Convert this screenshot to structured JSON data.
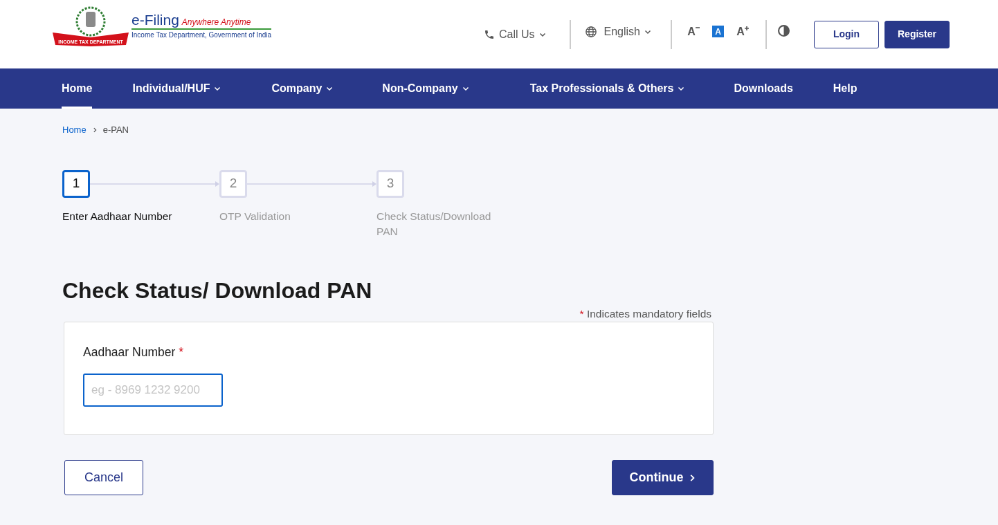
{
  "logo": {
    "ribbon": "INCOME TAX DEPARTMENT",
    "title": "e-Filing",
    "tagline": "Anywhere Anytime",
    "subtitle": "Income Tax Department, Government of India"
  },
  "header": {
    "call_us": {
      "label": "Call Us",
      "dropdown": true
    },
    "language": {
      "label": "English",
      "dropdown": true
    },
    "font_sizes": [
      {
        "label": "A",
        "kind": "decrease",
        "selected": false
      },
      {
        "label": "A",
        "kind": "normal",
        "selected": true
      },
      {
        "label": "A",
        "kind": "increase",
        "selected": false
      }
    ],
    "buttons": [
      {
        "label": "Login",
        "kind": "outline"
      },
      {
        "label": "Register",
        "kind": "primary"
      }
    ]
  },
  "nav": [
    {
      "label": "Home",
      "dropdown": false,
      "selected": true
    },
    {
      "label": "Individual/HUF",
      "dropdown": true,
      "selected": false
    },
    {
      "label": "Company",
      "dropdown": true,
      "selected": false
    },
    {
      "label": "Non-Company",
      "dropdown": true,
      "selected": false
    },
    {
      "label": "Tax Professionals & Others",
      "dropdown": true,
      "selected": false
    },
    {
      "label": "Downloads",
      "dropdown": false,
      "selected": false
    },
    {
      "label": "Help",
      "dropdown": false,
      "selected": false
    }
  ],
  "breadcrumb": [
    {
      "label": "Home",
      "link": true
    },
    {
      "label": "e-PAN",
      "link": false
    }
  ],
  "steps": [
    {
      "number": "1",
      "label": "Enter Aadhaar Number",
      "selected": true
    },
    {
      "number": "2",
      "label": "OTP Validation",
      "selected": false
    },
    {
      "number": "3",
      "label": "Check Status/Download PAN",
      "selected": false
    }
  ],
  "heading": "Check Status/ Download PAN",
  "mandatory_note": {
    "star": "*",
    "text": "Indicates mandatory fields"
  },
  "form": {
    "label": "Aadhaar Number",
    "required": true,
    "placeholder": "eg - 8969 1232 9200"
  },
  "actions": [
    {
      "label": "Cancel",
      "kind": "outline"
    },
    {
      "label": "Continue",
      "kind": "primary"
    }
  ]
}
